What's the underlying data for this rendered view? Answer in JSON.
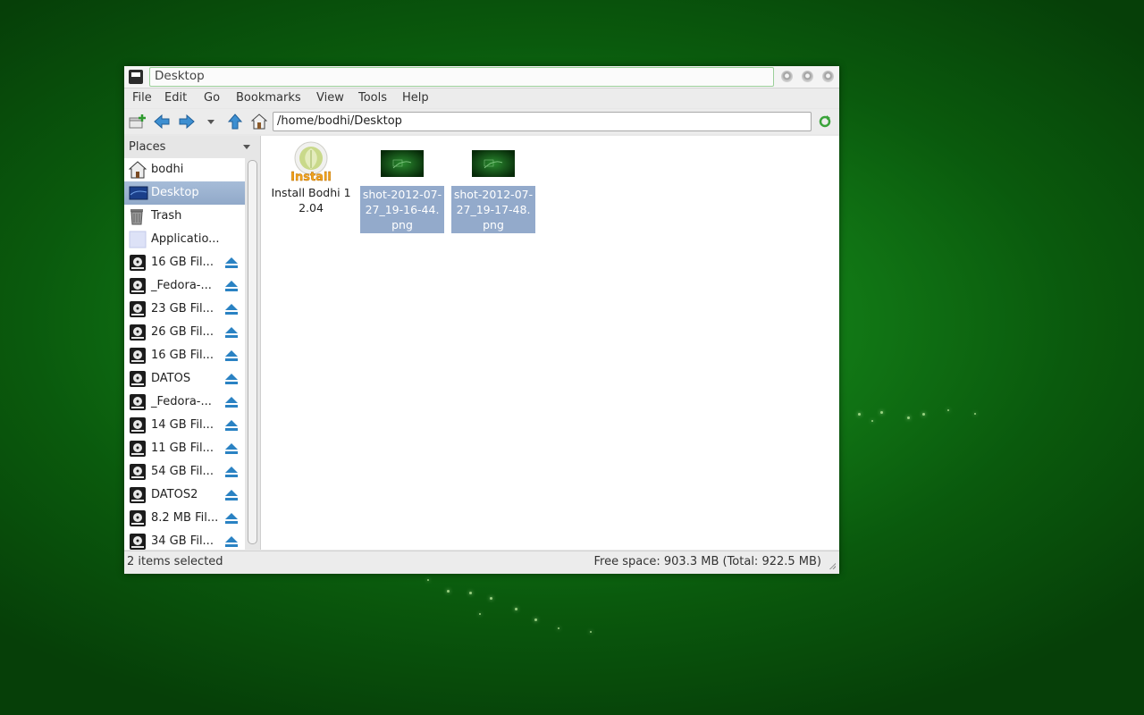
{
  "window": {
    "title": "Desktop"
  },
  "menu": [
    "File",
    "Edit",
    "Go",
    "Bookmarks",
    "View",
    "Tools",
    "Help"
  ],
  "toolbar": {
    "path": "/home/bodhi/Desktop",
    "icons": [
      "new-tab-icon",
      "back-arrow-icon",
      "forward-arrow-icon",
      "history-dropdown-icon",
      "up-arrow-icon",
      "home-icon",
      "go-refresh-icon"
    ]
  },
  "sidebar": {
    "header": "Places",
    "items": [
      {
        "label": "bodhi",
        "icon": "home-folder-icon"
      },
      {
        "label": "Desktop",
        "icon": "desktop-icon",
        "selected": true
      },
      {
        "label": "Trash",
        "icon": "trash-icon"
      },
      {
        "label": "Applicatio...",
        "icon": "applications-icon"
      },
      {
        "label": "16 GB Fil...",
        "icon": "drive-icon",
        "eject": true
      },
      {
        "label": "_Fedora-...",
        "icon": "drive-icon",
        "eject": true
      },
      {
        "label": "23 GB Fil...",
        "icon": "drive-icon",
        "eject": true
      },
      {
        "label": "26 GB Fil...",
        "icon": "drive-icon",
        "eject": true
      },
      {
        "label": "16 GB Fil...",
        "icon": "drive-icon",
        "eject": true
      },
      {
        "label": "DATOS",
        "icon": "drive-icon",
        "eject": true
      },
      {
        "label": "_Fedora-...",
        "icon": "drive-icon",
        "eject": true
      },
      {
        "label": "14 GB Fil...",
        "icon": "drive-icon",
        "eject": true
      },
      {
        "label": "11 GB Fil...",
        "icon": "drive-icon",
        "eject": true
      },
      {
        "label": "54 GB Fil...",
        "icon": "drive-icon",
        "eject": true
      },
      {
        "label": "DATOS2",
        "icon": "drive-icon",
        "eject": true
      },
      {
        "label": "8.2 MB Fil...",
        "icon": "drive-icon",
        "eject": true
      },
      {
        "label": "34 GB Fil...",
        "icon": "drive-icon",
        "eject": true
      }
    ]
  },
  "files": [
    {
      "label": "Install Bodhi 12.04",
      "icon": "install-bodhi-icon",
      "selected": false,
      "icon_text": "Install"
    },
    {
      "label": "shot-2012-07-27_19-16-44.png",
      "icon": "image-thumbnail-icon",
      "selected": true
    },
    {
      "label": "shot-2012-07-27_19-17-48.png",
      "icon": "image-thumbnail-icon",
      "selected": true
    }
  ],
  "status": {
    "left": "2 items selected",
    "right": "Free space: 903.3 MB (Total: 922.5 MB)"
  },
  "colors": {
    "selection": "#93aacb",
    "eject": "#2a82c3",
    "desktop_green": "#127a16"
  }
}
